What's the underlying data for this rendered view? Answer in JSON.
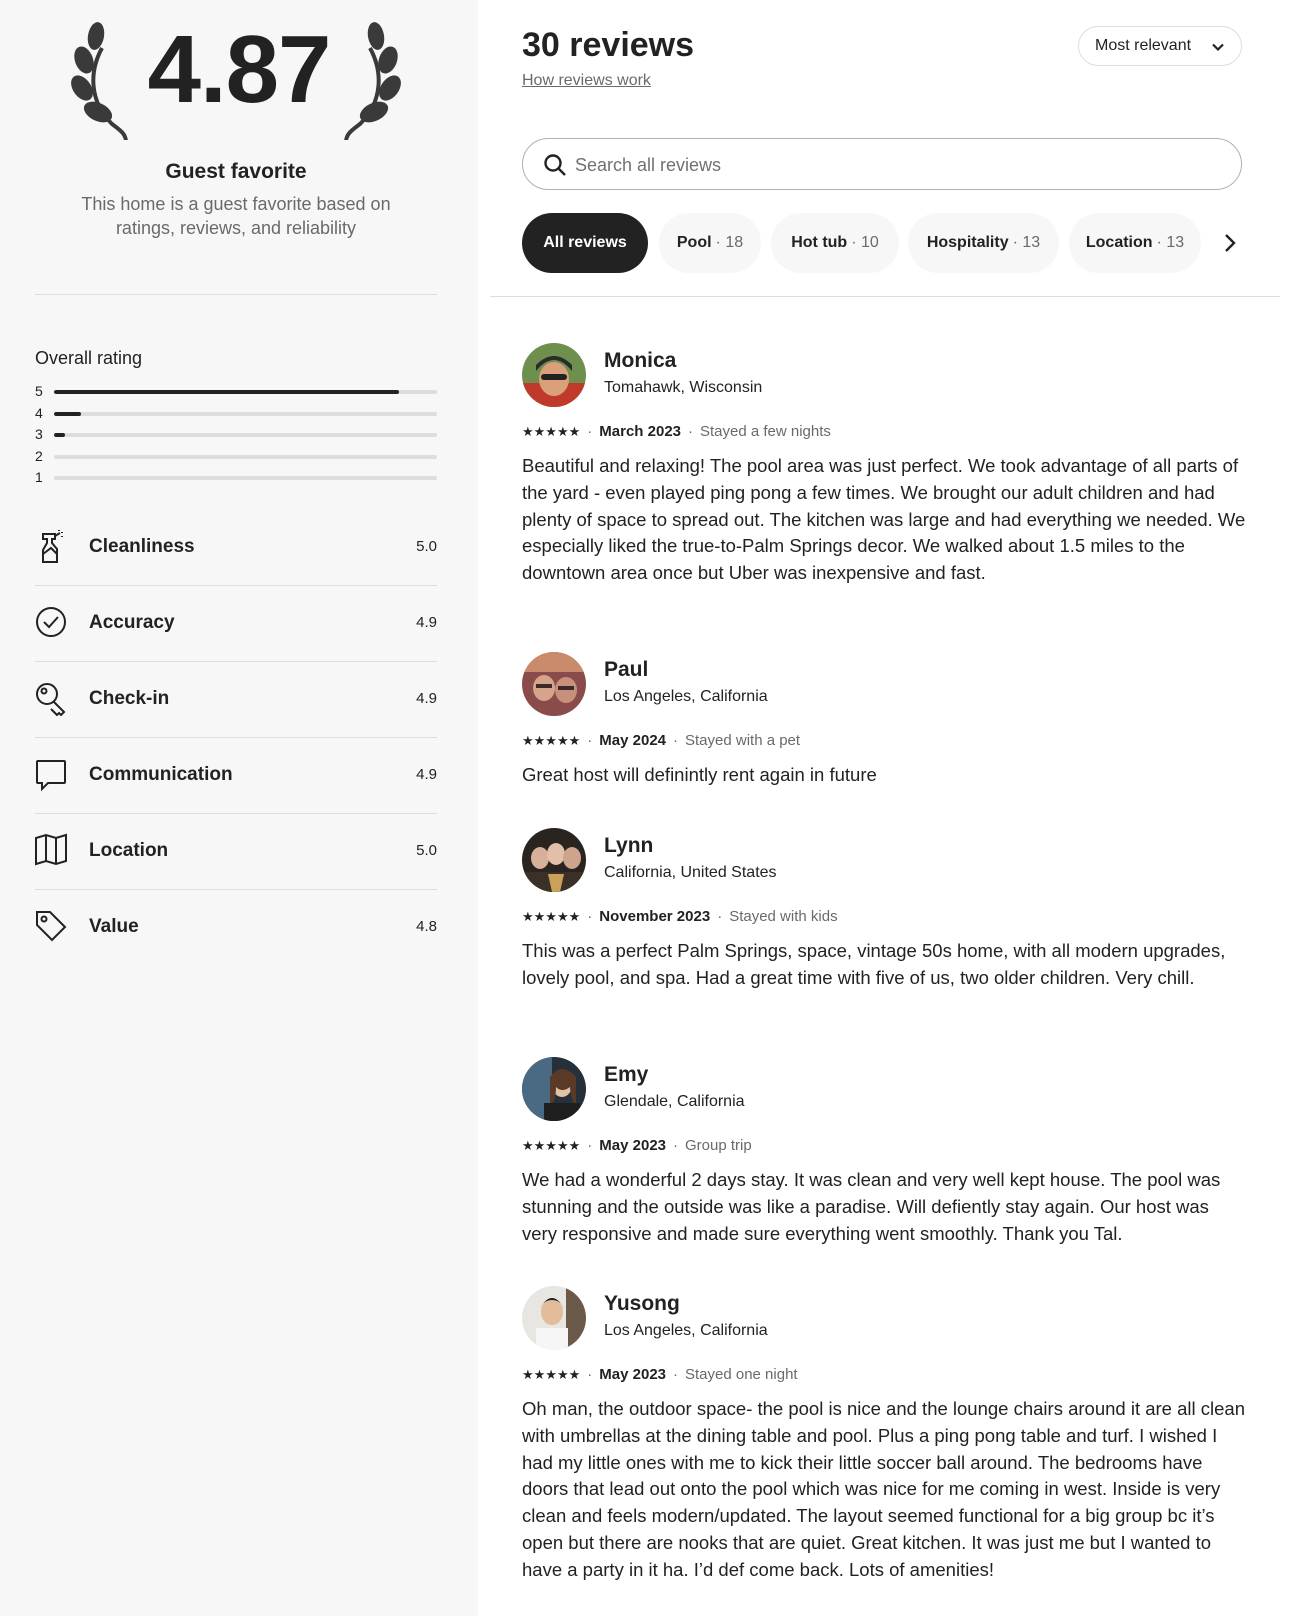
{
  "summary": {
    "rating": "4.87",
    "badge_title": "Guest favorite",
    "badge_description": "This home is a guest favorite based on ratings, reviews, and reliability"
  },
  "overall": {
    "title": "Overall rating",
    "distribution": [
      {
        "stars": "5",
        "fraction": 0.9
      },
      {
        "stars": "4",
        "fraction": 0.07
      },
      {
        "stars": "3",
        "fraction": 0.03
      },
      {
        "stars": "2",
        "fraction": 0.0
      },
      {
        "stars": "1",
        "fraction": 0.0
      }
    ]
  },
  "categories": [
    {
      "icon": "spray-bottle-icon",
      "label": "Cleanliness",
      "value": "5.0"
    },
    {
      "icon": "check-circle-icon",
      "label": "Accuracy",
      "value": "4.9"
    },
    {
      "icon": "key-icon",
      "label": "Check-in",
      "value": "4.9"
    },
    {
      "icon": "speech-bubble-icon",
      "label": "Communication",
      "value": "4.9"
    },
    {
      "icon": "map-icon",
      "label": "Location",
      "value": "5.0"
    },
    {
      "icon": "tag-icon",
      "label": "Value",
      "value": "4.8"
    }
  ],
  "reviews_header": {
    "title": "30 reviews",
    "how_link": "How reviews work",
    "sort_label": "Most relevant"
  },
  "search": {
    "placeholder": "Search all reviews",
    "value": ""
  },
  "filters": [
    {
      "name": "All reviews",
      "count": "",
      "active": true
    },
    {
      "name": "Pool",
      "count": "· 18",
      "active": false
    },
    {
      "name": "Hot tub",
      "count": "· 10",
      "active": false
    },
    {
      "name": "Hospitality",
      "count": "· 13",
      "active": false
    },
    {
      "name": "Location",
      "count": "· 13",
      "active": false
    }
  ],
  "reviews": [
    {
      "name": "Monica",
      "location": "Tomahawk, Wisconsin",
      "stars": "★★★★★",
      "date": "March 2023",
      "stay": "Stayed a few nights",
      "text": "Beautiful and relaxing! The pool area was just perfect. We took advantage of all parts of the yard - even played ping pong a few times. We brought our adult children and had plenty of space to spread out. The kitchen was large and had everything we needed. We especially liked the true-to-Palm Springs decor. We walked about 1.5 miles to the downtown area once but Uber was inexpensive and fast."
    },
    {
      "name": "Paul",
      "location": "Los Angeles, California",
      "stars": "★★★★★",
      "date": "May 2024",
      "stay": "Stayed with a pet",
      "text": "Great host will definintly rent again in future"
    },
    {
      "name": "Lynn",
      "location": "California, United States",
      "stars": "★★★★★",
      "date": "November 2023",
      "stay": "Stayed with kids",
      "text": "This was a perfect Palm Springs, space, vintage 50s home, with all modern upgrades, lovely pool, and spa. Had a great time with five of us, two older children. Very chill."
    },
    {
      "name": "Emy",
      "location": "Glendale, California",
      "stars": "★★★★★",
      "date": "May 2023",
      "stay": "Group trip",
      "text": "We had a wonderful 2 days stay. It was clean and very well kept house. The pool was stunning and the outside was like a paradise. Will defiently stay again. Our host was very responsive and made sure everything went smoothly. Thank you Tal."
    },
    {
      "name": "Yusong",
      "location": "Los Angeles, California",
      "stars": "★★★★★",
      "date": "May 2023",
      "stay": "Stayed one night",
      "text": "Oh man, the outdoor space- the pool is nice and the lounge chairs around it are all clean with umbrellas at the dining table and pool. Plus a ping pong table and turf. I wished I had my little ones with me to kick their little soccer ball around.  The bedrooms have doors that lead out onto the pool which was nice for me coming in west.  Inside is very clean and feels modern/updated.  The layout seemed functional for a big group bc it’s open but there are nooks that are quiet. Great kitchen. It was just me but I wanted to have a party in it ha. I’d def come back. Lots of amenities!"
    }
  ]
}
